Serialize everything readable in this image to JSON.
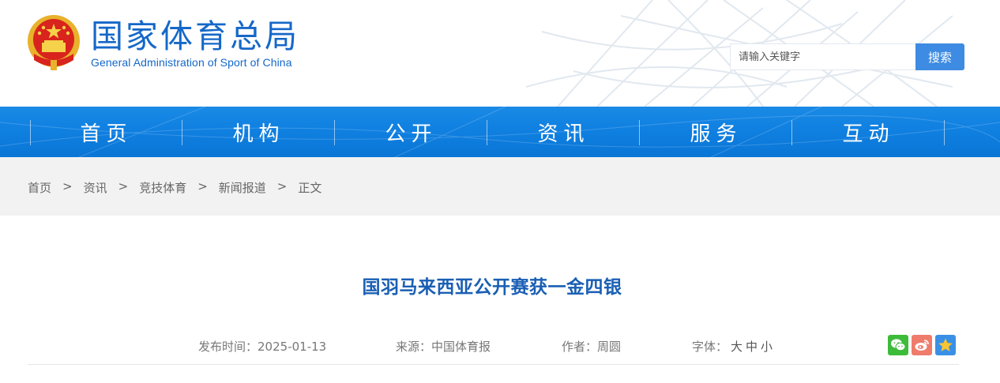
{
  "site": {
    "title": "国家体育总局",
    "subtitle": "General Administration of Sport of China"
  },
  "search": {
    "placeholder": "请输入关键字",
    "button_label": "搜索"
  },
  "nav": {
    "items": [
      {
        "label": "首页"
      },
      {
        "label": "机构"
      },
      {
        "label": "公开"
      },
      {
        "label": "资讯"
      },
      {
        "label": "服务"
      },
      {
        "label": "互动"
      }
    ]
  },
  "breadcrumb": {
    "items": [
      {
        "label": "首页"
      },
      {
        "label": "资讯"
      },
      {
        "label": "竞技体育"
      },
      {
        "label": "新闻报道"
      },
      {
        "label": "正文"
      }
    ],
    "separator": ">"
  },
  "article": {
    "title": "国羽马来西亚公开赛获一金四银",
    "publish_label": "发布时间：",
    "publish_date": "2025-01-13",
    "source_label": "来源：",
    "source": "中国体育报",
    "author_label": "作者：",
    "author": "周圆",
    "font_label": "字体：",
    "font_sizes": [
      "大",
      "中",
      "小"
    ]
  },
  "share": {
    "icons": [
      "wechat-icon",
      "weibo-icon",
      "favorite-star-icon"
    ]
  },
  "colors": {
    "brand_blue": "#1568c8",
    "nav_blue": "#0f7fe0",
    "title_blue": "#1a5fb4",
    "search_button": "#3d8be2"
  }
}
